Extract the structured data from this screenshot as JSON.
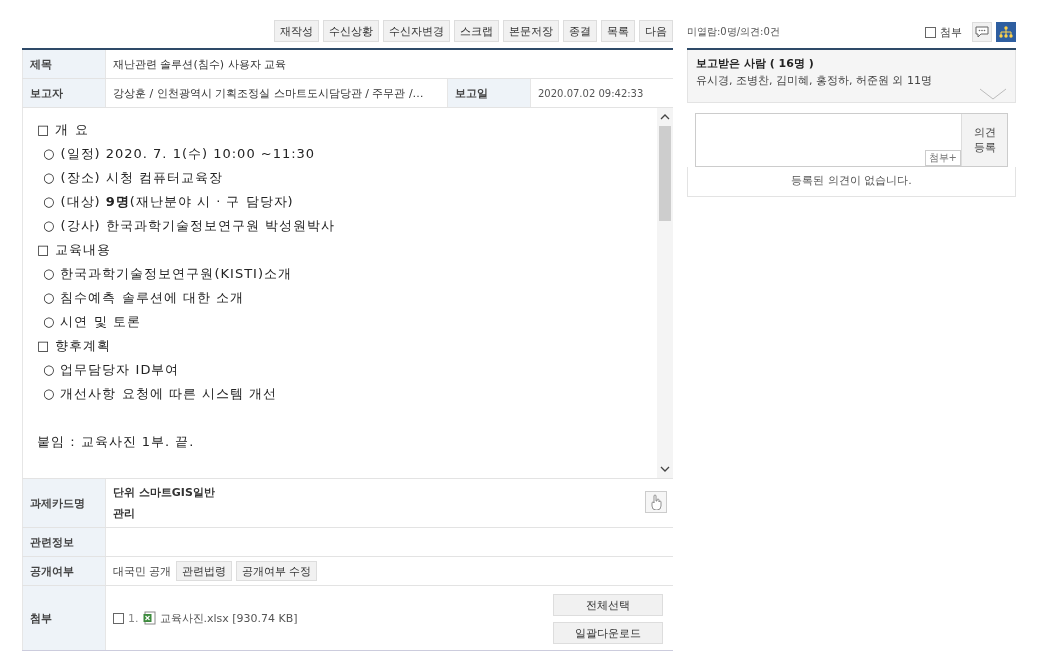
{
  "toolbar": {
    "buttons": [
      "재작성",
      "수신상황",
      "수신자변경",
      "스크랩",
      "본문저장",
      "종결",
      "목록",
      "다음"
    ]
  },
  "report": {
    "title_label": "제목",
    "title": "재난관련 솔루션(침수) 사용자 교육",
    "reporter_label": "보고자",
    "reporter": "강상훈 / 인천광역시 기획조정실 스마트도시담당관 / 주무관 /…",
    "date_label": "보고일",
    "date": "2020.07.02 09:42:33",
    "body": [
      {
        "kind": "section",
        "text": "□ 개 요"
      },
      {
        "kind": "item",
        "text": "○ (일정) 2020. 7. 1(수) 10:00 ~11:30"
      },
      {
        "kind": "item",
        "text": "○ (장소) 시청 컴퓨터교육장"
      },
      {
        "kind": "item",
        "text": "○ (대상) **9명**(재난분야 시 · 구 담당자)"
      },
      {
        "kind": "item",
        "text": "○ (강사) 한국과학기술정보연구원 박성원박사"
      },
      {
        "kind": "section",
        "text": "□ 교육내용"
      },
      {
        "kind": "item",
        "text": "○ 한국과학기술정보연구원(KISTI)소개"
      },
      {
        "kind": "item",
        "text": "○ 침수예측 솔루션에 대한 소개"
      },
      {
        "kind": "item",
        "text": "○ 시연 및 토론"
      },
      {
        "kind": "section",
        "text": "□ 향후계획"
      },
      {
        "kind": "item",
        "text": "○ 업무담당자 ID부여"
      },
      {
        "kind": "item",
        "text": "○ 개선사항 요청에 따른 시스템 개선"
      },
      {
        "kind": "note",
        "text": "붙임 : 교육사진 1부. 끝."
      }
    ],
    "task_label": "과제카드명",
    "task_lines": [
      "단위 스마트GIS일반",
      "관리"
    ],
    "related_label": "관련정보",
    "disclosure_label": "공개여부",
    "disclosure": "대국민 공개",
    "disclosure_buttons": [
      "관련법령",
      "공개여부 수정"
    ],
    "attach_label": "첨부",
    "attachments": [
      {
        "number": "1.",
        "name": "교육사진.xlsx [930.74 KB]",
        "checked": false
      }
    ],
    "attach_buttons": [
      "전체선택",
      "일괄다운로드"
    ]
  },
  "side": {
    "status": "미열람:0명/의견:0건",
    "attach_filter": {
      "label": "첨부",
      "checked": false
    },
    "org_view_selected": true,
    "recipients_title": "보고받은 사람 ( 16명 )",
    "recipients": "유시경, 조병찬, 김미혜, 홍정하, 허준원 외 11명",
    "attach_add": "첨부+",
    "submit": "의견\n등록",
    "empty": "등록된 의견이 없습니다."
  }
}
